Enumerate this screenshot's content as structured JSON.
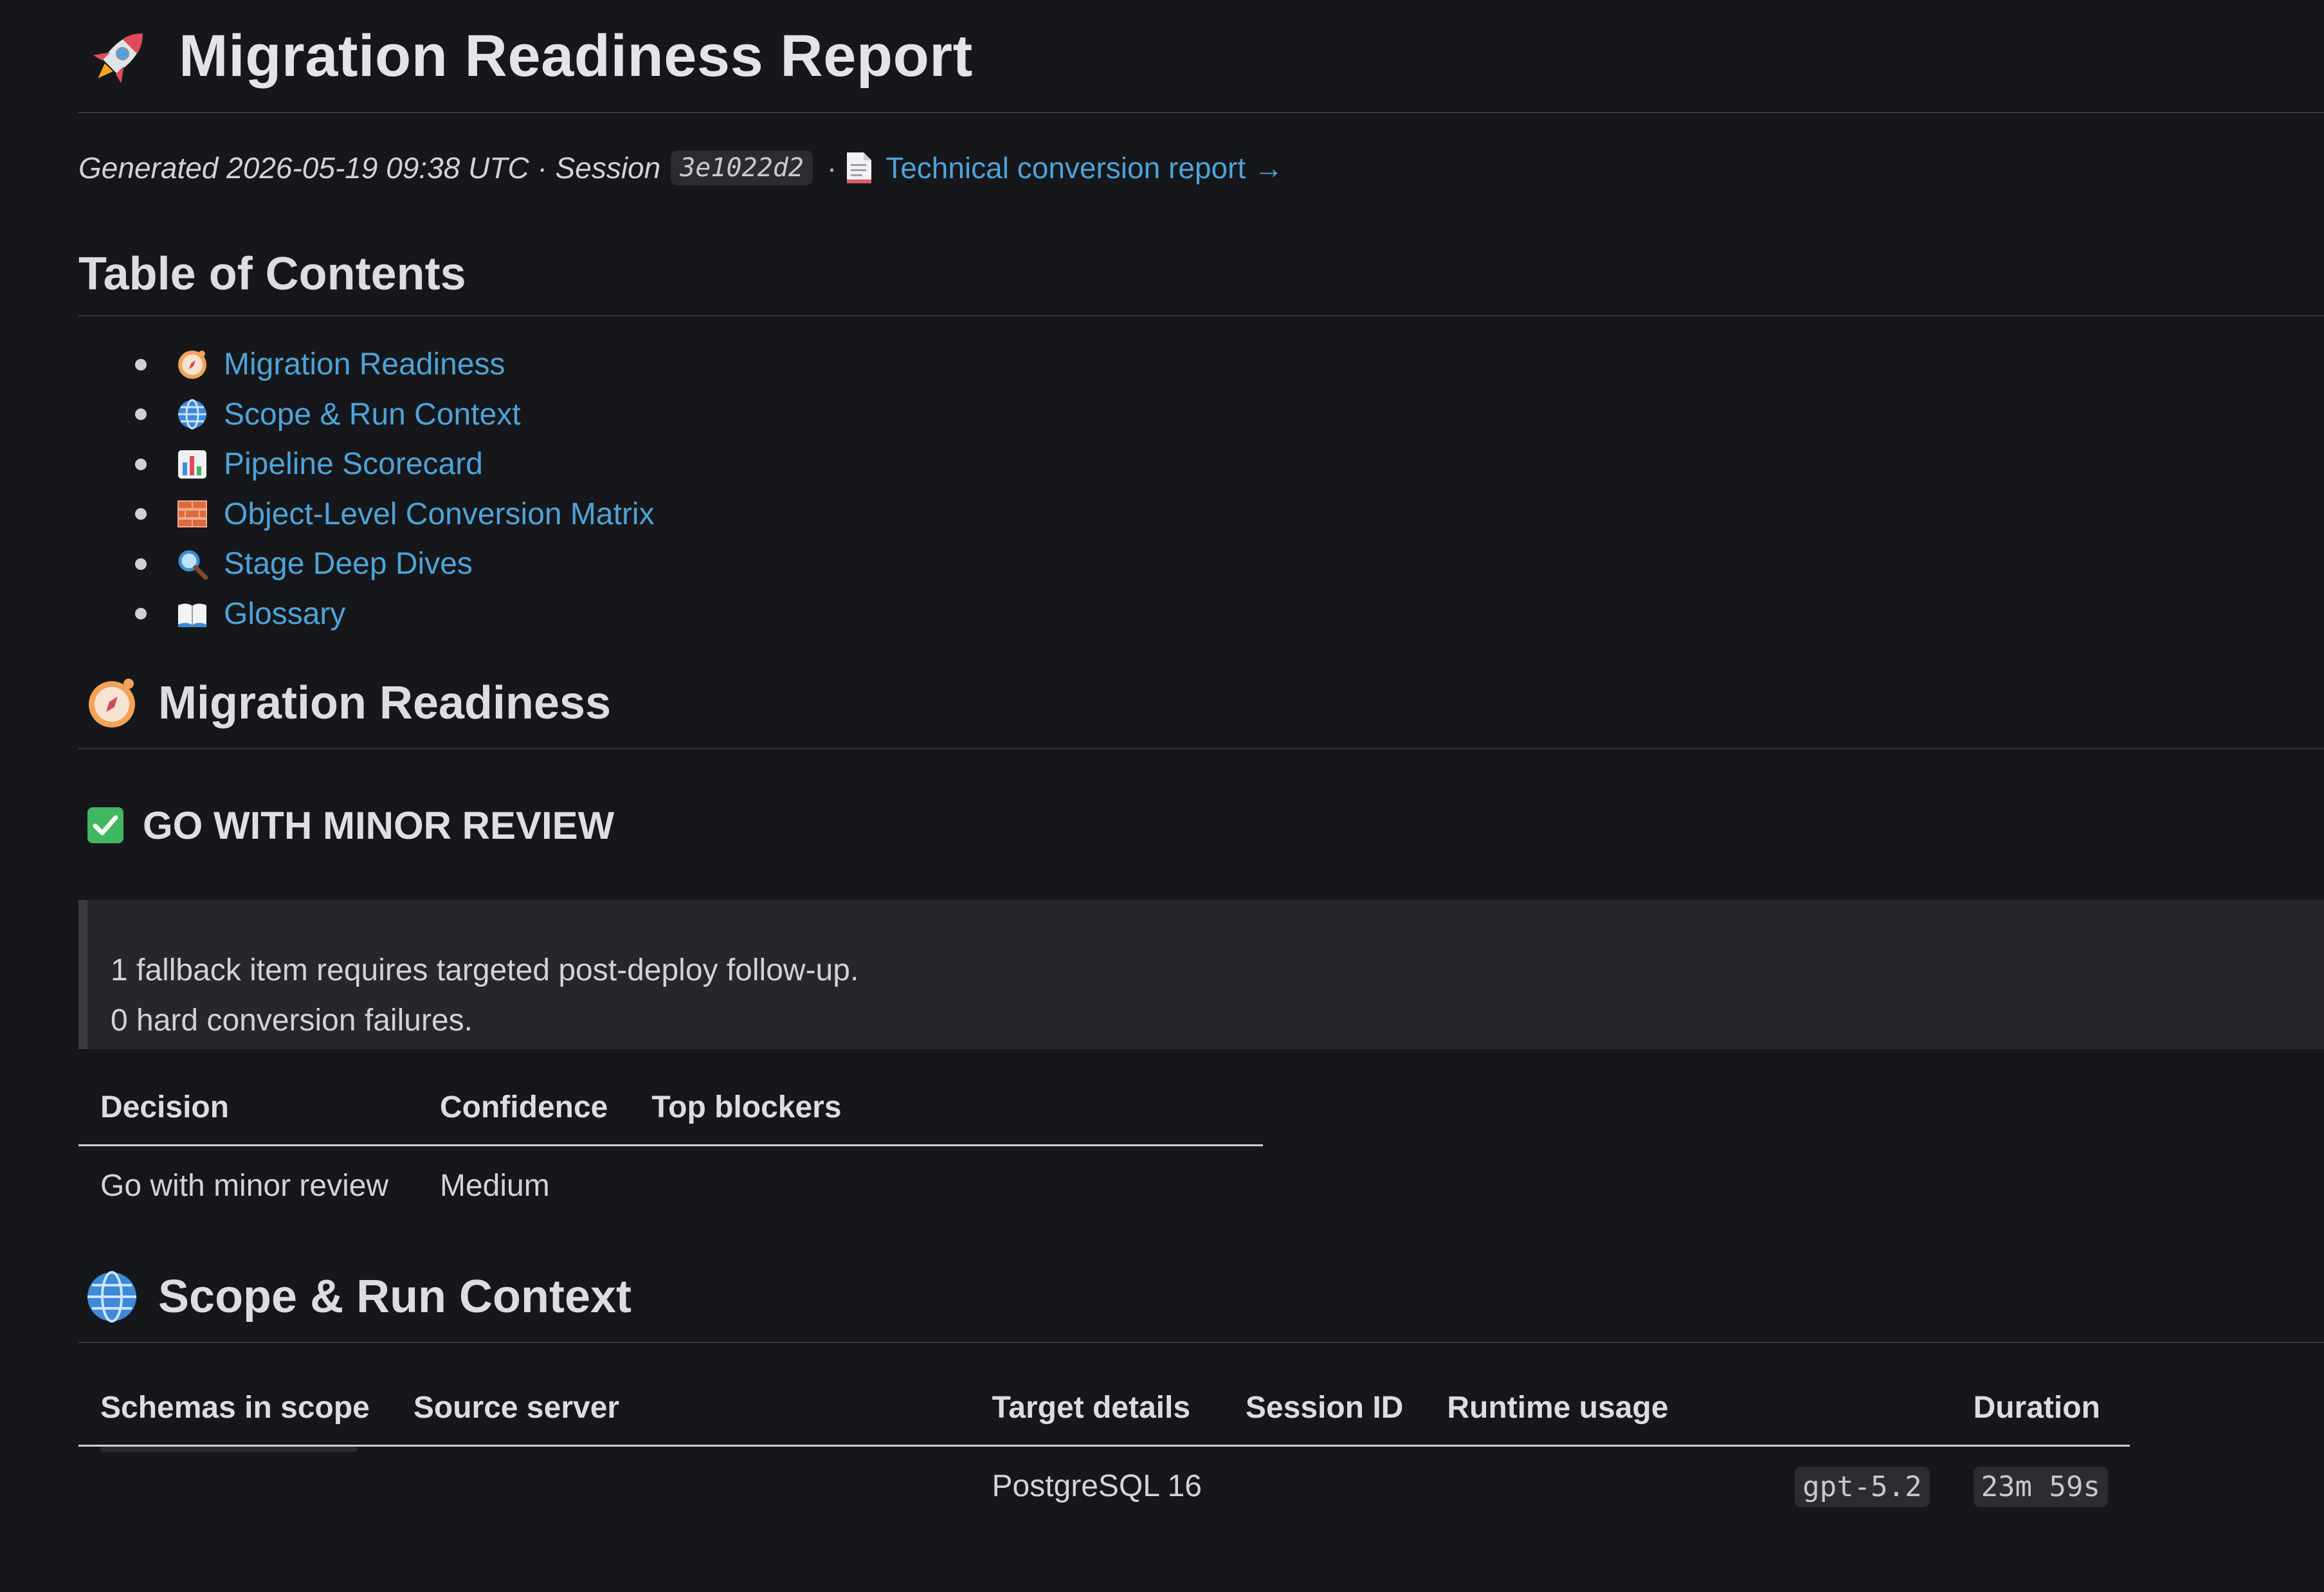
{
  "header": {
    "title": "Migration Readiness Report",
    "generated_prefix": "Generated 2026-05-19 09:38 UTC · Session",
    "session_code": "3e1022d2",
    "separator": "·",
    "tech_link": "Technical conversion report →"
  },
  "toc": {
    "title": "Table of Contents",
    "items": [
      {
        "icon": "compass-icon",
        "label": "Migration Readiness"
      },
      {
        "icon": "globe-icon",
        "label": "Scope & Run Context"
      },
      {
        "icon": "bar-chart-icon",
        "label": "Pipeline Scorecard"
      },
      {
        "icon": "brick-icon",
        "label": "Object-Level Conversion Matrix"
      },
      {
        "icon": "magnifier-icon",
        "label": "Stage Deep Dives"
      },
      {
        "icon": "book-icon",
        "label": "Glossary"
      }
    ]
  },
  "readiness": {
    "title": "Migration Readiness",
    "verdict": "GO WITH MINOR REVIEW",
    "callout_lines": [
      "1 fallback item requires targeted post-deploy follow-up.",
      "0 hard conversion failures."
    ],
    "table": {
      "headers": [
        "Decision",
        "Confidence",
        "Top blockers"
      ],
      "row": [
        "Go with minor review",
        "Medium",
        ""
      ]
    }
  },
  "scope": {
    "title": "Scope & Run Context",
    "table": {
      "headers": [
        "Schemas in scope",
        "Source server",
        "Target details",
        "Session ID",
        "Runtime usage",
        "Duration"
      ],
      "row": {
        "schemas": "",
        "source": "",
        "target": "PostgreSQL 16",
        "session": "",
        "runtime": "gpt-5.2",
        "duration": "23m 59s"
      }
    }
  },
  "colors": {
    "background": "#16171b",
    "link": "#4ea3d8",
    "text": "#d7d8db"
  }
}
